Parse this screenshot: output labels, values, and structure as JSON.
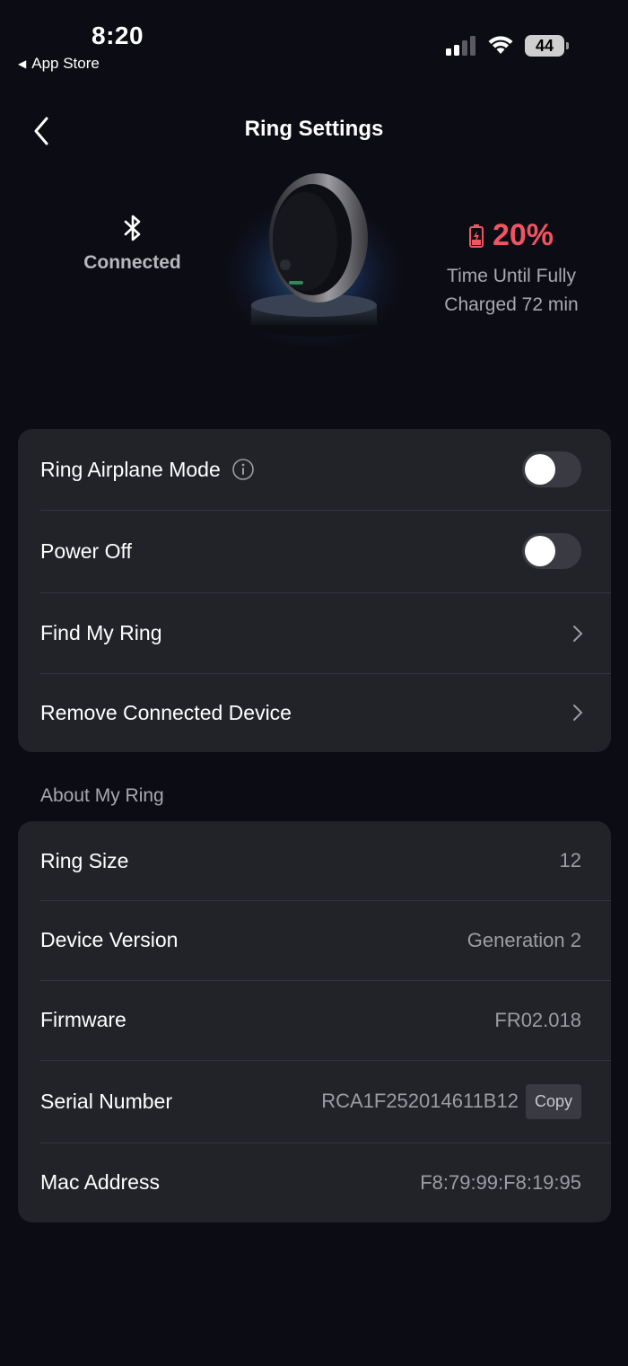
{
  "status_bar": {
    "time": "8:20",
    "back_app": "App Store",
    "battery_level": "44"
  },
  "nav": {
    "title": "Ring Settings"
  },
  "hero": {
    "bluetooth_status": "Connected",
    "battery_percent": "20%",
    "charge_text_line1": "Time Until Fully",
    "charge_text_line2": "Charged 72 min"
  },
  "settings": {
    "airplane_mode_label": "Ring Airplane Mode",
    "airplane_mode_on": false,
    "power_off_label": "Power Off",
    "power_off_on": false,
    "find_ring_label": "Find My Ring",
    "remove_device_label": "Remove Connected Device"
  },
  "about": {
    "header": "About My Ring",
    "ring_size_label": "Ring Size",
    "ring_size_value": "12",
    "device_version_label": "Device Version",
    "device_version_value": "Generation 2",
    "firmware_label": "Firmware",
    "firmware_value": "FR02.018",
    "serial_label": "Serial Number",
    "serial_value": "RCA1F252014611B12",
    "copy_label": "Copy",
    "mac_label": "Mac Address",
    "mac_value": "F8:79:99:F8:19:95"
  },
  "colors": {
    "accent_battery": "#ef5461",
    "card_bg": "#222329",
    "page_bg": "#0c0c14"
  }
}
